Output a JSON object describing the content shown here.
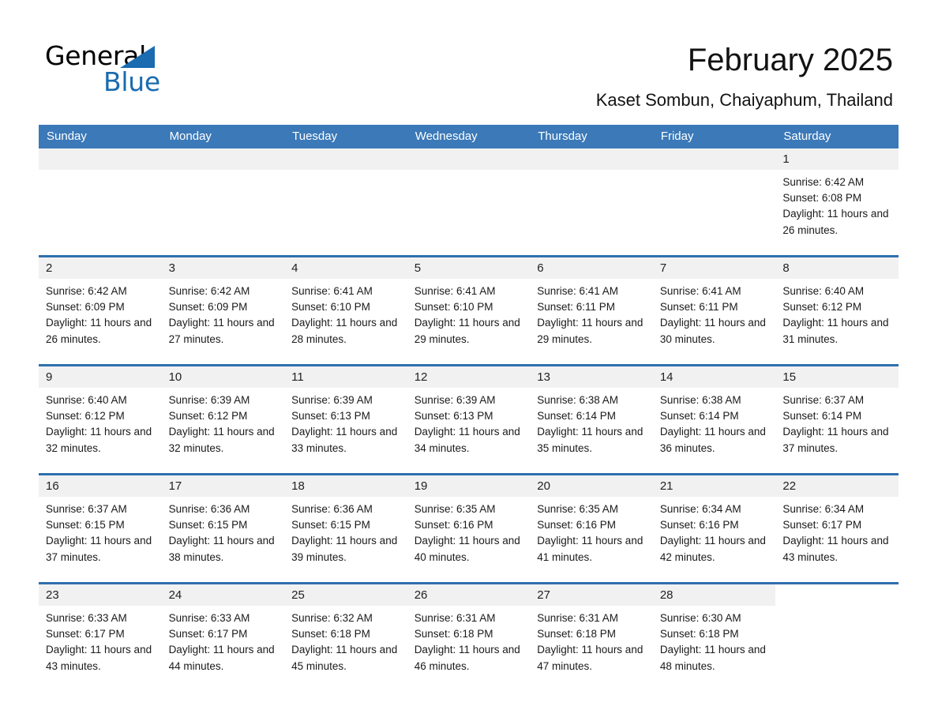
{
  "brand": {
    "name_part1": "General",
    "name_part2": "Blue",
    "triangle_color": "#1a6bb0",
    "accent_color": "#3b79b8"
  },
  "header": {
    "title": "February 2025",
    "subtitle": "Kaset Sombun, Chaiyaphum, Thailand"
  },
  "calendar": {
    "weekday_headers": [
      "Sunday",
      "Monday",
      "Tuesday",
      "Wednesday",
      "Thursday",
      "Friday",
      "Saturday"
    ],
    "weeks": [
      [
        {
          "day": "",
          "empty": true
        },
        {
          "day": "",
          "empty": true
        },
        {
          "day": "",
          "empty": true
        },
        {
          "day": "",
          "empty": true
        },
        {
          "day": "",
          "empty": true
        },
        {
          "day": "",
          "empty": true
        },
        {
          "day": "1",
          "sunrise": "Sunrise: 6:42 AM",
          "sunset": "Sunset: 6:08 PM",
          "daylight": "Daylight: 11 hours and 26 minutes."
        }
      ],
      [
        {
          "day": "2",
          "sunrise": "Sunrise: 6:42 AM",
          "sunset": "Sunset: 6:09 PM",
          "daylight": "Daylight: 11 hours and 26 minutes."
        },
        {
          "day": "3",
          "sunrise": "Sunrise: 6:42 AM",
          "sunset": "Sunset: 6:09 PM",
          "daylight": "Daylight: 11 hours and 27 minutes."
        },
        {
          "day": "4",
          "sunrise": "Sunrise: 6:41 AM",
          "sunset": "Sunset: 6:10 PM",
          "daylight": "Daylight: 11 hours and 28 minutes."
        },
        {
          "day": "5",
          "sunrise": "Sunrise: 6:41 AM",
          "sunset": "Sunset: 6:10 PM",
          "daylight": "Daylight: 11 hours and 29 minutes."
        },
        {
          "day": "6",
          "sunrise": "Sunrise: 6:41 AM",
          "sunset": "Sunset: 6:11 PM",
          "daylight": "Daylight: 11 hours and 29 minutes."
        },
        {
          "day": "7",
          "sunrise": "Sunrise: 6:41 AM",
          "sunset": "Sunset: 6:11 PM",
          "daylight": "Daylight: 11 hours and 30 minutes."
        },
        {
          "day": "8",
          "sunrise": "Sunrise: 6:40 AM",
          "sunset": "Sunset: 6:12 PM",
          "daylight": "Daylight: 11 hours and 31 minutes."
        }
      ],
      [
        {
          "day": "9",
          "sunrise": "Sunrise: 6:40 AM",
          "sunset": "Sunset: 6:12 PM",
          "daylight": "Daylight: 11 hours and 32 minutes."
        },
        {
          "day": "10",
          "sunrise": "Sunrise: 6:39 AM",
          "sunset": "Sunset: 6:12 PM",
          "daylight": "Daylight: 11 hours and 32 minutes."
        },
        {
          "day": "11",
          "sunrise": "Sunrise: 6:39 AM",
          "sunset": "Sunset: 6:13 PM",
          "daylight": "Daylight: 11 hours and 33 minutes."
        },
        {
          "day": "12",
          "sunrise": "Sunrise: 6:39 AM",
          "sunset": "Sunset: 6:13 PM",
          "daylight": "Daylight: 11 hours and 34 minutes."
        },
        {
          "day": "13",
          "sunrise": "Sunrise: 6:38 AM",
          "sunset": "Sunset: 6:14 PM",
          "daylight": "Daylight: 11 hours and 35 minutes."
        },
        {
          "day": "14",
          "sunrise": "Sunrise: 6:38 AM",
          "sunset": "Sunset: 6:14 PM",
          "daylight": "Daylight: 11 hours and 36 minutes."
        },
        {
          "day": "15",
          "sunrise": "Sunrise: 6:37 AM",
          "sunset": "Sunset: 6:14 PM",
          "daylight": "Daylight: 11 hours and 37 minutes."
        }
      ],
      [
        {
          "day": "16",
          "sunrise": "Sunrise: 6:37 AM",
          "sunset": "Sunset: 6:15 PM",
          "daylight": "Daylight: 11 hours and 37 minutes."
        },
        {
          "day": "17",
          "sunrise": "Sunrise: 6:36 AM",
          "sunset": "Sunset: 6:15 PM",
          "daylight": "Daylight: 11 hours and 38 minutes."
        },
        {
          "day": "18",
          "sunrise": "Sunrise: 6:36 AM",
          "sunset": "Sunset: 6:15 PM",
          "daylight": "Daylight: 11 hours and 39 minutes."
        },
        {
          "day": "19",
          "sunrise": "Sunrise: 6:35 AM",
          "sunset": "Sunset: 6:16 PM",
          "daylight": "Daylight: 11 hours and 40 minutes."
        },
        {
          "day": "20",
          "sunrise": "Sunrise: 6:35 AM",
          "sunset": "Sunset: 6:16 PM",
          "daylight": "Daylight: 11 hours and 41 minutes."
        },
        {
          "day": "21",
          "sunrise": "Sunrise: 6:34 AM",
          "sunset": "Sunset: 6:16 PM",
          "daylight": "Daylight: 11 hours and 42 minutes."
        },
        {
          "day": "22",
          "sunrise": "Sunrise: 6:34 AM",
          "sunset": "Sunset: 6:17 PM",
          "daylight": "Daylight: 11 hours and 43 minutes."
        }
      ],
      [
        {
          "day": "23",
          "sunrise": "Sunrise: 6:33 AM",
          "sunset": "Sunset: 6:17 PM",
          "daylight": "Daylight: 11 hours and 43 minutes."
        },
        {
          "day": "24",
          "sunrise": "Sunrise: 6:33 AM",
          "sunset": "Sunset: 6:17 PM",
          "daylight": "Daylight: 11 hours and 44 minutes."
        },
        {
          "day": "25",
          "sunrise": "Sunrise: 6:32 AM",
          "sunset": "Sunset: 6:18 PM",
          "daylight": "Daylight: 11 hours and 45 minutes."
        },
        {
          "day": "26",
          "sunrise": "Sunrise: 6:31 AM",
          "sunset": "Sunset: 6:18 PM",
          "daylight": "Daylight: 11 hours and 46 minutes."
        },
        {
          "day": "27",
          "sunrise": "Sunrise: 6:31 AM",
          "sunset": "Sunset: 6:18 PM",
          "daylight": "Daylight: 11 hours and 47 minutes."
        },
        {
          "day": "28",
          "sunrise": "Sunrise: 6:30 AM",
          "sunset": "Sunset: 6:18 PM",
          "daylight": "Daylight: 11 hours and 48 minutes."
        },
        {
          "day": "",
          "empty": true,
          "trailing": true
        }
      ]
    ]
  }
}
